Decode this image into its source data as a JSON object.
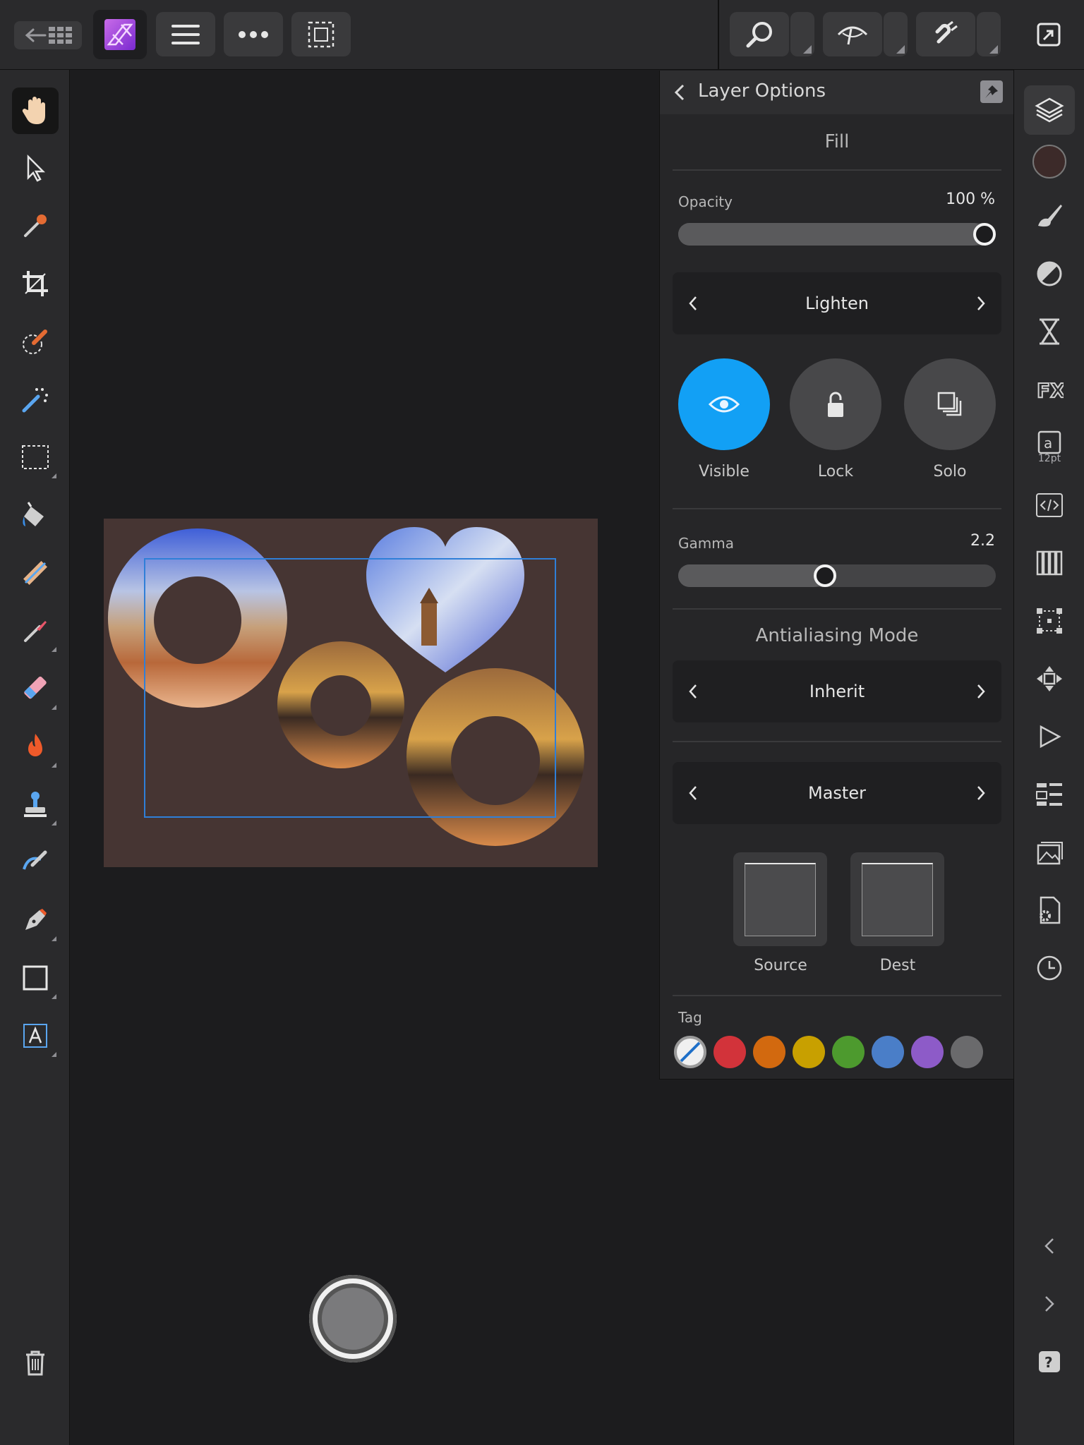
{
  "panel": {
    "title": "Layer Options",
    "fill_title": "Fill",
    "opacity_label": "Opacity",
    "opacity_value": "100 %",
    "opacity_fraction": 1.0,
    "blend_mode": "Lighten",
    "visible_label": "Visible",
    "lock_label": "Lock",
    "solo_label": "Solo",
    "gamma_label": "Gamma",
    "gamma_value": "2.2",
    "gamma_fraction": 0.46,
    "antialias_title": "Antialiasing Mode",
    "antialias_mode": "Inherit",
    "channel": "Master",
    "source_label": "Source",
    "dest_label": "Dest",
    "tag_label": "Tag",
    "tag_colors": [
      "none",
      "#d2333a",
      "#d2690f",
      "#c8a000",
      "#4d9a2e",
      "#4a7ec8",
      "#8d5bc8",
      "#6a6a6c"
    ]
  },
  "studio": {
    "text_size": "12pt"
  },
  "colors": {
    "accent": "#12a0f5",
    "document_bg": "#463533",
    "current_color": "#3c2a29"
  }
}
